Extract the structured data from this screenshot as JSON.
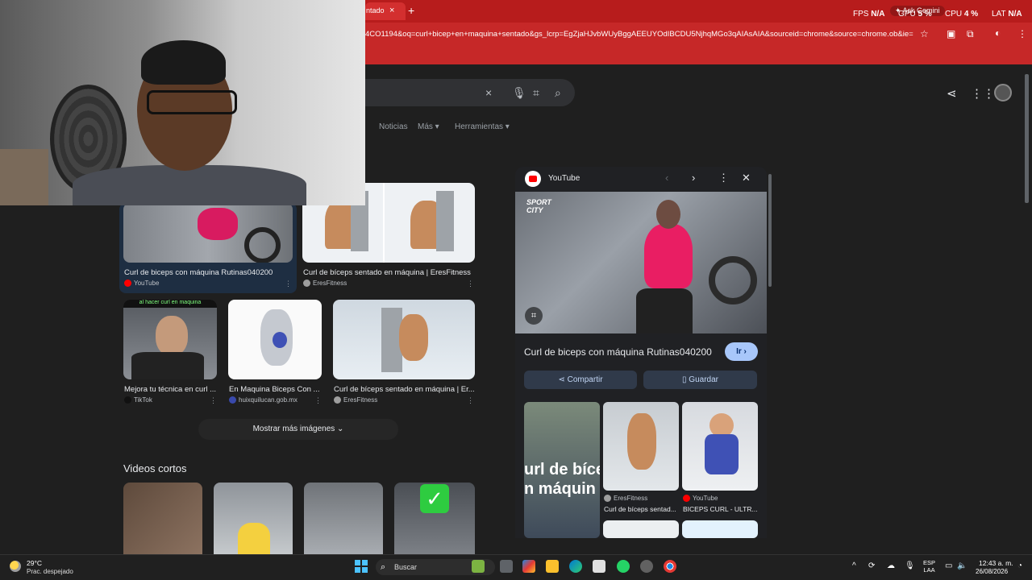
{
  "browser": {
    "tab_title": "ntado",
    "tab_close": "×",
    "new_tab": "+",
    "url": "4CO1194&oq=curl+bicep+en+maquina+sentado&gs_lcrp=EgZjaHJvbWUyBggAEEUYOdIBCDU5NjhqMGo3qAIAsAIA&sourceid=chrome&source=chrome.ob&ie=U...",
    "gemini_chip": "Ask Gemini",
    "overlay_stats": [
      {
        "label": "FPS",
        "value": "N/A"
      },
      {
        "label": "GPU",
        "value": "5 %"
      },
      {
        "label": "CPU",
        "value": "4 %"
      },
      {
        "label": "LAT",
        "value": "N/A"
      }
    ]
  },
  "search": {
    "clear_icon": "×",
    "filters": [
      "Noticias",
      "Más",
      "Herramientas"
    ]
  },
  "results": [
    {
      "title": "Curl de biceps con máquina Rutinas040200",
      "source": "YouTube",
      "src_color": "#ff0000"
    },
    {
      "title": "Curl de bíceps sentado en máquina | EresFitness",
      "source": "EresFitness",
      "src_color": "#9e9e9e"
    },
    {
      "title": "Mejora tu técnica en curl ...",
      "source": "TikTok",
      "src_color": "#111111"
    },
    {
      "title": "En Maquina Biceps Con ...",
      "source": "huixquilucan.gob.mx",
      "src_color": "#3949ab"
    },
    {
      "title": "Curl de bíceps sentado en máquina | Er...",
      "source": "EresFitness",
      "src_color": "#9e9e9e"
    }
  ],
  "more_images": "Mostrar más imágenes",
  "videos_title": "Videos cortos",
  "panel": {
    "source": "YouTube",
    "title": "Curl de biceps con máquina Rutinas040200",
    "visit": "Ir",
    "share": "Compartir",
    "save": "Guardar",
    "image_brand": "SPORT CITY",
    "related": [
      {
        "overlay": "url de bíce\nn máquin",
        "source": "",
        "title": ""
      },
      {
        "source": "EresFitness",
        "title": "Curl de bíceps sentad..."
      },
      {
        "source": "YouTube",
        "title": "BICEPS CURL - ULTR..."
      }
    ]
  },
  "taskbar": {
    "temperature": "29°C",
    "weather": "Prac. despejado",
    "search_placeholder": "Buscar",
    "language_top": "ESP",
    "language_bottom": "LAA",
    "time": "12:43 a. m.",
    "date": "26/08/2026"
  }
}
